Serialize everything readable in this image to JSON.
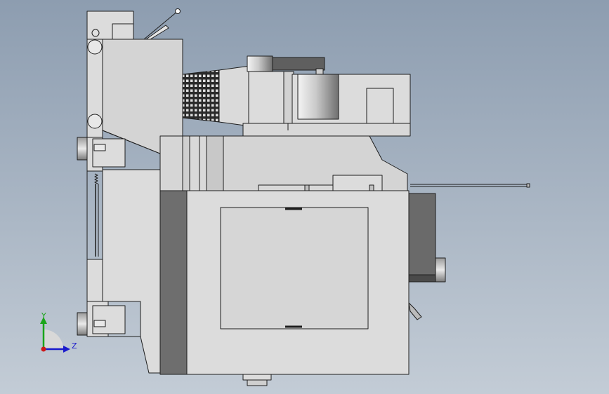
{
  "viewport": {
    "background_top": "#8d9db0",
    "background_bottom": "#c3ccd6"
  },
  "model": {
    "fill_light": "#dcdcdc",
    "fill_mid": "#c4c4c4",
    "fill_dark": "#6e6e6e",
    "edge": "#1e1e1e"
  },
  "triad": {
    "y_label": "Y",
    "z_label": "Z",
    "y_color": "#1aa51a",
    "z_color": "#1a1acc",
    "origin_color": "#cc1a1a"
  }
}
